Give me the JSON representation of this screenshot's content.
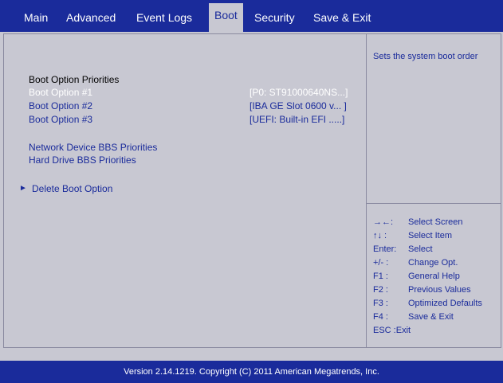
{
  "tabs": [
    "Main",
    "Advanced",
    "Event Logs",
    "Boot",
    "Security",
    "Save & Exit"
  ],
  "section_title": "Boot Option Priorities",
  "boot_options": [
    {
      "label": "Boot Option #1",
      "value": "[P0: ST91000640NS...]"
    },
    {
      "label": "Boot Option #2",
      "value": "[IBA GE Slot 0600 v... ]"
    },
    {
      "label": "Boot Option #3",
      "value": "[UEFI: Built-in EFI .....]"
    }
  ],
  "links": {
    "network": "Network Device BBS Priorities",
    "harddrive": "Hard Drive BBS Priorities",
    "delete_arrow": "►",
    "delete": "Delete Boot Option"
  },
  "help_text": "Sets the system boot order",
  "key_help": [
    {
      "key": "→←:",
      "desc": "Select Screen"
    },
    {
      "key": "↑↓ :",
      "desc": "Select Item"
    },
    {
      "key": "Enter:",
      "desc": "Select"
    },
    {
      "key": "+/- :",
      "desc": "Change Opt."
    },
    {
      "key": "F1 :",
      "desc": "General Help"
    },
    {
      "key": "F2 :",
      "desc": "Previous Values"
    },
    {
      "key": "F3 :",
      "desc": "Optimized Defaults"
    },
    {
      "key": "F4 :",
      "desc": "Save & Exit"
    },
    {
      "key": "ESC :Exit",
      "desc": ""
    }
  ],
  "footer": "Version 2.14.1219. Copyright (C) 2011 American Megatrends, Inc.",
  "colors": {
    "accent": "#1a2b9b",
    "panel": "#c8c8d2",
    "text_selected": "#ffffff"
  }
}
